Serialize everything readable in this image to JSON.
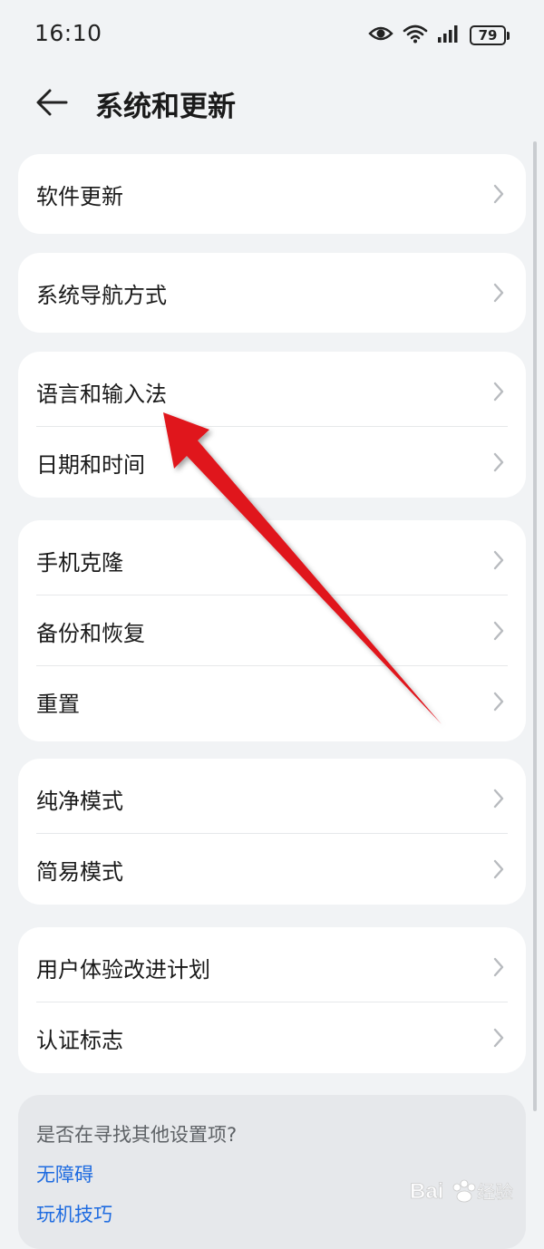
{
  "status": {
    "time": "16:10",
    "battery": "79"
  },
  "header": {
    "title": "系统和更新"
  },
  "groups": [
    {
      "items": [
        {
          "label": "软件更新"
        }
      ]
    },
    {
      "items": [
        {
          "label": "系统导航方式"
        }
      ]
    },
    {
      "items": [
        {
          "label": "语言和输入法"
        },
        {
          "label": "日期和时间"
        }
      ]
    },
    {
      "items": [
        {
          "label": "手机克隆"
        },
        {
          "label": "备份和恢复"
        },
        {
          "label": "重置"
        }
      ]
    },
    {
      "items": [
        {
          "label": "纯净模式"
        },
        {
          "label": "简易模式"
        }
      ]
    },
    {
      "items": [
        {
          "label": "用户体验改进计划"
        },
        {
          "label": "认证标志"
        }
      ]
    }
  ],
  "suggestions": {
    "title": "是否在寻找其他设置项?",
    "links": [
      "无障碍",
      "玩机技巧"
    ]
  },
  "colors": {
    "background": "#f1f3f5",
    "link": "#1e6be0",
    "annotation_arrow": "#e0141e"
  },
  "watermark": {
    "text": "Bai 经验"
  }
}
